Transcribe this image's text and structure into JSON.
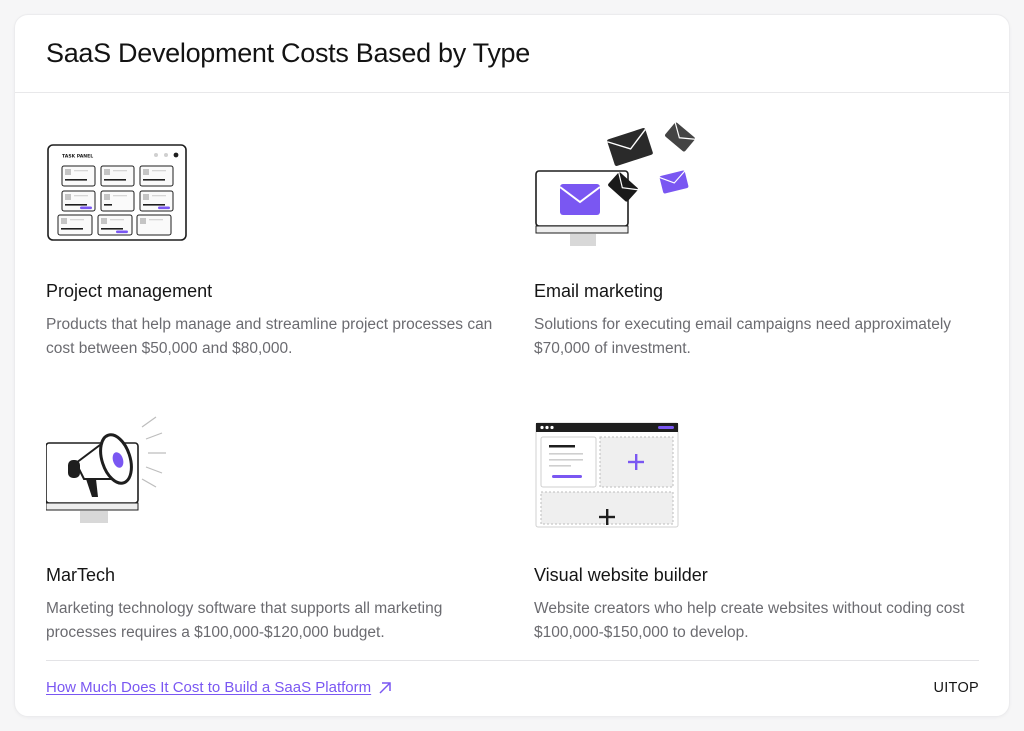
{
  "header": {
    "title": "SaaS Development Costs Based by Type"
  },
  "items": [
    {
      "title": "Project management",
      "description": "Products that help manage and streamline project processes can cost between $50,000 and $80,000.",
      "illustration_label": "TASK PANEL",
      "icon": "task-panel-icon"
    },
    {
      "title": "Email marketing",
      "description": "Solutions for executing email campaigns need approximately $70,000 of investment.",
      "icon": "email-envelopes-icon"
    },
    {
      "title": "MarTech",
      "description": "Marketing technology software that supports all marketing processes requires a $100,000-$120,000 budget.",
      "icon": "megaphone-icon"
    },
    {
      "title": "Visual website builder",
      "description": "Website creators who help create websites without coding cost $100,000-$150,000 to develop.",
      "icon": "website-builder-icon"
    }
  ],
  "footer": {
    "link_text": "How Much Does It Cost to Build a SaaS Platform",
    "link_icon": "arrow-up-right-icon",
    "brand": "UITOP"
  },
  "colors": {
    "accent": "#7a57f2",
    "dark": "#1e1e1e",
    "muted_text": "#6b6b70"
  }
}
